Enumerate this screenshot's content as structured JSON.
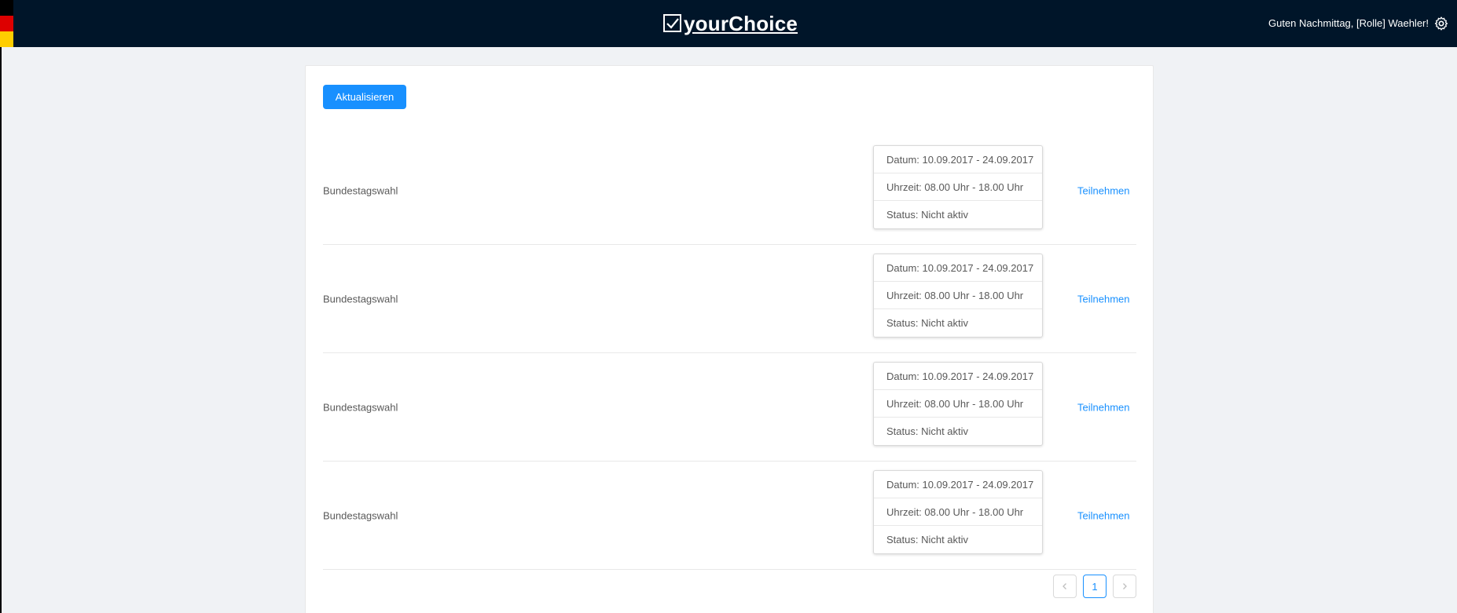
{
  "header": {
    "brand": "yourChoice",
    "greeting": "Guten Nachmittag, [Rolle] Waehler!",
    "flag_colors": [
      "#000000",
      "#dd0000",
      "#ffce00"
    ]
  },
  "toolbar": {
    "refresh_label": "Aktualisieren"
  },
  "elections": [
    {
      "name": "Bundestagswahl",
      "date": "Datum: 10.09.2017 - 24.09.2017",
      "time": "Uhrzeit: 08.00 Uhr - 18.00 Uhr",
      "status": "Status: Nicht aktiv",
      "action": "Teilnehmen"
    },
    {
      "name": "Bundestagswahl",
      "date": "Datum: 10.09.2017 - 24.09.2017",
      "time": "Uhrzeit: 08.00 Uhr - 18.00 Uhr",
      "status": "Status: Nicht aktiv",
      "action": "Teilnehmen"
    },
    {
      "name": "Bundestagswahl",
      "date": "Datum: 10.09.2017 - 24.09.2017",
      "time": "Uhrzeit: 08.00 Uhr - 18.00 Uhr",
      "status": "Status: Nicht aktiv",
      "action": "Teilnehmen"
    },
    {
      "name": "Bundestagswahl",
      "date": "Datum: 10.09.2017 - 24.09.2017",
      "time": "Uhrzeit: 08.00 Uhr - 18.00 Uhr",
      "status": "Status: Nicht aktiv",
      "action": "Teilnehmen"
    }
  ],
  "pagination": {
    "prev_icon": "chevron-left-icon",
    "current_page": "1",
    "next_icon": "chevron-right-icon"
  },
  "colors": {
    "header_bg": "#001529",
    "accent": "#1890ff",
    "page_bg": "#f0f2f5"
  }
}
